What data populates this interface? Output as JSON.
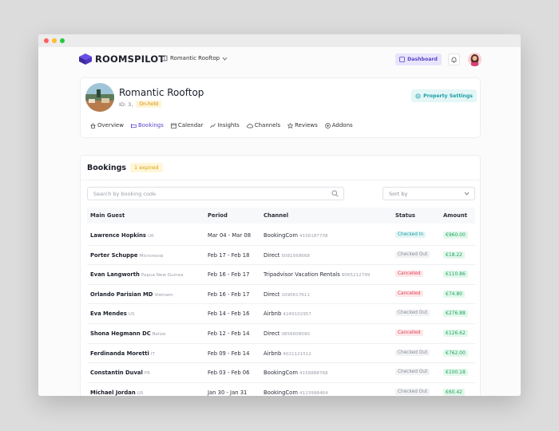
{
  "app": {
    "logo_text": "ROOMSPILOT"
  },
  "topnav": {
    "property_selector": "Romantic Rooftop",
    "dashboard_label": "Dashboard"
  },
  "property": {
    "name": "Romantic Rooftop",
    "id_label": "ID: 3,",
    "status_badge": "On-hold",
    "settings_label": "Property Settings",
    "tabs": [
      {
        "label": "Overview",
        "icon": "home-icon"
      },
      {
        "label": "Bookings",
        "icon": "bed-icon"
      },
      {
        "label": "Calendar",
        "icon": "calendar-icon"
      },
      {
        "label": "Insights",
        "icon": "chart-icon"
      },
      {
        "label": "Channels",
        "icon": "cloud-icon"
      },
      {
        "label": "Reviews",
        "icon": "star-icon"
      },
      {
        "label": "Addons",
        "icon": "plus-circle-icon"
      }
    ]
  },
  "bookings": {
    "title": "Bookings",
    "expired_badge": "1 expired",
    "search_placeholder": "Search by booking code",
    "sort_placeholder": "Sort by",
    "columns": [
      "Main Guest",
      "Period",
      "Channel",
      "Status",
      "Amount"
    ],
    "rows": [
      {
        "guest": "Lawrence Hopkins",
        "country": "UK",
        "period": "Mar 04 - Mar 08",
        "channel": "BookingCom",
        "channel_id": "4156187738",
        "status": "Checked In",
        "amount": "€960.00"
      },
      {
        "guest": "Porter Schuppe",
        "country": "Micronesia",
        "period": "Feb 17 - Feb 18",
        "channel": "Direct",
        "channel_id": "5081568668",
        "status": "Checked Out",
        "amount": "€18.22"
      },
      {
        "guest": "Evan Langworth",
        "country": "Papua New Guinea",
        "period": "Feb 16 - Feb 17",
        "channel": "Tripadvisor Vacation Rentals",
        "channel_id": "8065212799",
        "status": "Cancelled",
        "amount": "€110.86"
      },
      {
        "guest": "Orlando Parisian MD",
        "country": "Vietnam",
        "period": "Feb 16 - Feb 17",
        "channel": "Direct",
        "channel_id": "1090617611",
        "status": "Cancelled",
        "amount": "€74.80"
      },
      {
        "guest": "Eva Mendes",
        "country": "US",
        "period": "Feb 14 - Feb 16",
        "channel": "Airbnb",
        "channel_id": "4249102957",
        "status": "Checked Out",
        "amount": "€276.88"
      },
      {
        "guest": "Shona Hegmann DC",
        "country": "Belize",
        "period": "Feb 12 - Feb 14",
        "channel": "Direct",
        "channel_id": "0856608090",
        "status": "Cancelled",
        "amount": "€126.62"
      },
      {
        "guest": "Ferdinanda Moretti",
        "country": "IT",
        "period": "Feb 09 - Feb 14",
        "channel": "Airbnb",
        "channel_id": "4021121512",
        "status": "Checked Out",
        "amount": "€762.00"
      },
      {
        "guest": "Constantin Duval",
        "country": "FR",
        "period": "Feb 03 - Feb 06",
        "channel": "BookingCom",
        "channel_id": "4158888768",
        "status": "Checked Out",
        "amount": "€100.18"
      },
      {
        "guest": "Michael Jordan",
        "country": "US",
        "period": "Jan 30 - Jan 31",
        "channel": "BookingCom",
        "channel_id": "4123998464",
        "status": "Checked Out",
        "amount": "€60.42"
      }
    ]
  },
  "colors": {
    "brand": "#5b45c9",
    "checked_in": "#1b9ea5",
    "checked_out": "#8a8e98",
    "cancelled": "#e03e52",
    "amount": "#1ba45b"
  }
}
